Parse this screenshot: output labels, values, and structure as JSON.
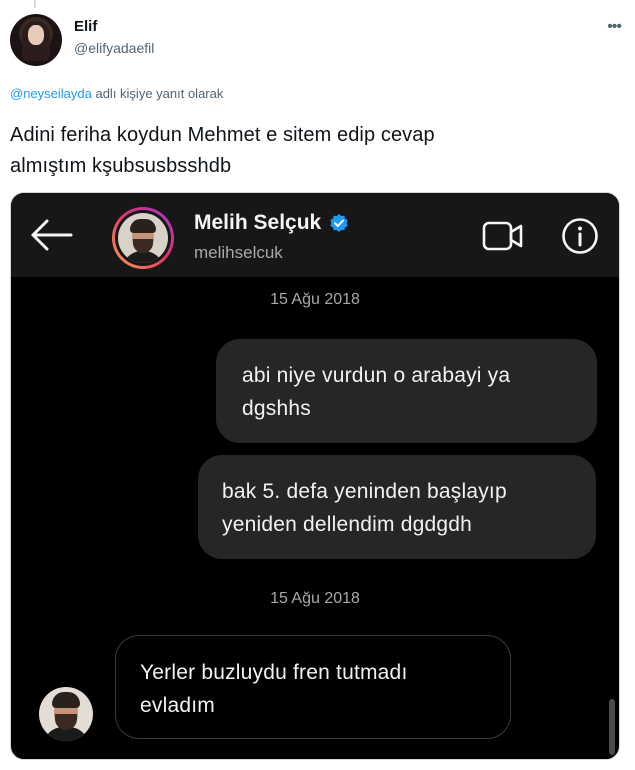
{
  "tweet": {
    "author": {
      "display_name": "Elif",
      "handle": "@elifyadaefil"
    },
    "reply_to": {
      "mention": "@neyseilayda",
      "suffix": " adlı kişiye yanıt olarak"
    },
    "text_line_1": "Adini feriha koydun Mehmet e sitem edip cevap",
    "text_line_2": "almıştım kşubsusbsshdb",
    "more_icon": "ellipsis-icon"
  },
  "dm": {
    "contact_name": "Melih Selçuk",
    "contact_username": "melihselcuk",
    "verified_color": "#1d9bf0",
    "header_bg": "#171717",
    "bubble_bg": "#262626",
    "dates": [
      "15 Ağu 2018",
      "15 Ağu 2018"
    ],
    "messages": [
      {
        "from": "me",
        "line1": "abi niye vurdun o arabayi ya",
        "line2": "dgshhs"
      },
      {
        "from": "me",
        "line1": "bak 5. defa yeninden başlayıp",
        "line2": "yeniden dellendim dgdgdh"
      },
      {
        "from": "contact",
        "line1": "Yerler buzluydu fren tutmadı",
        "line2": "evladım"
      }
    ],
    "icons": {
      "back": "arrow-left-icon",
      "video": "video-camera-icon",
      "info": "info-icon",
      "verified": "verified-badge-icon"
    }
  }
}
